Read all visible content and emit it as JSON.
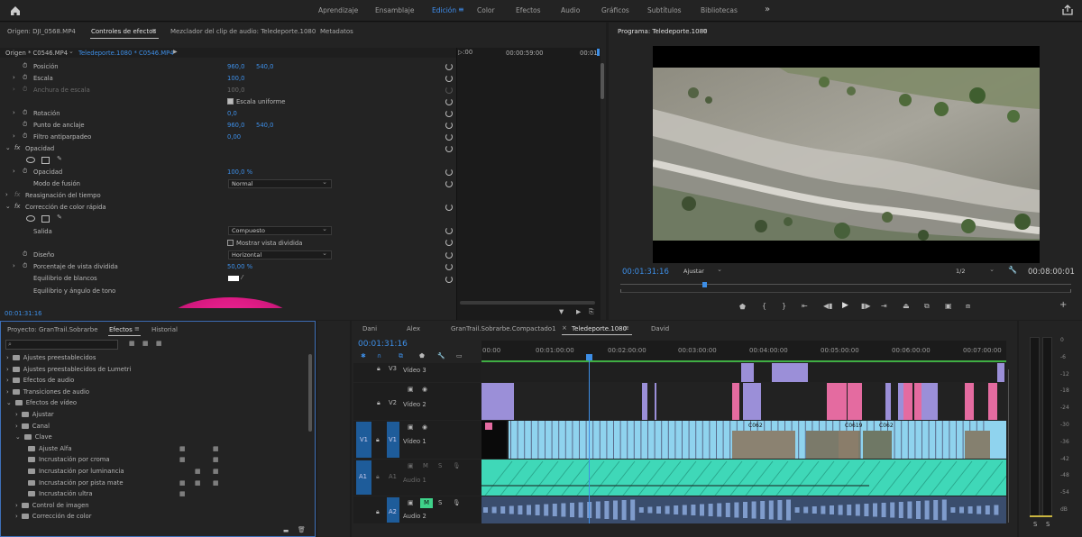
{
  "workspaces": [
    "Aprendizaje",
    "Ensamblaje",
    "Edición",
    "Color",
    "Efectos",
    "Audio",
    "Gráficos",
    "Subtítulos",
    "Bibliotecas"
  ],
  "active_workspace": "Edición",
  "source_panel": {
    "tabs": [
      "Origen: DJI_0568.MP4",
      "Controles de efectos",
      "Mezclador del clip de audio: Teledeporte.1080",
      "Metadatos"
    ],
    "active_tab": "Controles de efectos",
    "clip_selector": "Origen * C0546.MP4",
    "clip_selector2": "Teledeporte.1080 * C0546.MP4",
    "mini_timecode": "00:00:59:00",
    "mini_timecode2": "00:01",
    "timecode": "00:01:31:16",
    "props": {
      "posicion": "Posición",
      "posicion_x": "960,0",
      "posicion_y": "540,0",
      "escala": "Escala",
      "escala_v": "100,0",
      "anchura": "Anchura de escala",
      "anchura_v": "100,0",
      "escala_uniforme": "Escala uniforme",
      "rotacion": "Rotación",
      "rotacion_v": "0,0",
      "anclaje": "Punto de anclaje",
      "anclaje_x": "960,0",
      "anclaje_y": "540,0",
      "filtro": "Filtro antiparpadeo",
      "filtro_v": "0,00",
      "opacidad_hdr": "Opacidad",
      "opacidad": "Opacidad",
      "opacidad_v": "100,0 %",
      "modo": "Modo de fusión",
      "modo_v": "Normal",
      "reasignacion": "Reasignación del tiempo",
      "correccion": "Corrección de color rápida",
      "salida": "Salida",
      "salida_v": "Compuesto",
      "mostrar": "Mostrar vista dividida",
      "diseno": "Diseño",
      "diseno_v": "Horizontal",
      "porcentaje": "Porcentaje de vista dividida",
      "porcentaje_v": "50,00 %",
      "equilibrio": "Equilibrio de blancos",
      "equilibrio_tono": "Equilibrio y ángulo de tono"
    }
  },
  "program": {
    "title": "Programa: Teledeporte.1080",
    "timecode": "00:01:31:16",
    "fit": "Ajustar",
    "resolution": "1/2",
    "duration": "00:08:00:01"
  },
  "project": {
    "tabs": [
      "Proyecto: GranTrail.Sobrarbe",
      "Efectos",
      "Historial"
    ],
    "active_tab": "Efectos",
    "tree": [
      {
        "label": "Ajustes preestablecidos",
        "indent": 0
      },
      {
        "label": "Ajustes preestablecidos de Lumetri",
        "indent": 0
      },
      {
        "label": "Efectos de audio",
        "indent": 0
      },
      {
        "label": "Transiciones de audio",
        "indent": 0
      },
      {
        "label": "Efectos de vídeo",
        "indent": 0
      },
      {
        "label": "Ajustar",
        "indent": 1
      },
      {
        "label": "Canal",
        "indent": 1
      },
      {
        "label": "Clave",
        "indent": 1
      },
      {
        "label": "Ajuste Alfa",
        "indent": 2
      },
      {
        "label": "Incrustación por croma",
        "indent": 2
      },
      {
        "label": "Incrustación por luminancia",
        "indent": 2
      },
      {
        "label": "Incrustación por pista mate",
        "indent": 2
      },
      {
        "label": "Incrustación ultra",
        "indent": 2
      },
      {
        "label": "Control de imagen",
        "indent": 1
      },
      {
        "label": "Corrección de color",
        "indent": 1
      }
    ]
  },
  "timeline": {
    "tabs": [
      "Dani",
      "Alex",
      "GranTrail.Sobrarbe.Compactado1",
      "Teledeporte.1080",
      "David"
    ],
    "active_tab": "Teledeporte.1080",
    "timecode": "00:01:31:16",
    "ruler": [
      "00:00",
      "00:01:00:00",
      "00:02:00:00",
      "00:03:00:00",
      "00:04:00:00",
      "00:05:00:00",
      "00:06:00:00",
      "00:07:00:00"
    ],
    "tracks": {
      "v3": "V3",
      "v3_name": "Vídeo 3",
      "v2": "V2",
      "v2_name": "Vídeo 2",
      "v1": "V1",
      "v1_src": "V1",
      "v1_name": "Vídeo 1",
      "a1": "A1",
      "a1_src": "A1",
      "a1_name": "Audio 1",
      "a2": "A2",
      "a2_name": "Audio 2",
      "m": "M",
      "s": "S"
    },
    "clip_labels": [
      "C062",
      "C0619",
      "C062"
    ]
  },
  "meter": {
    "scale": [
      "0",
      "-6",
      "-12",
      "-18",
      "-24",
      "-30",
      "-36",
      "-42",
      "-48",
      "-54",
      "dB"
    ],
    "s_buttons": [
      "S",
      "S"
    ]
  },
  "colors": {
    "accent": "#3d8ee6",
    "video_purple": "#9b8fd8",
    "video_pink": "#e46ba0",
    "video_cyan": "#8fd3ee",
    "audio_teal": "#3fd8b8"
  }
}
